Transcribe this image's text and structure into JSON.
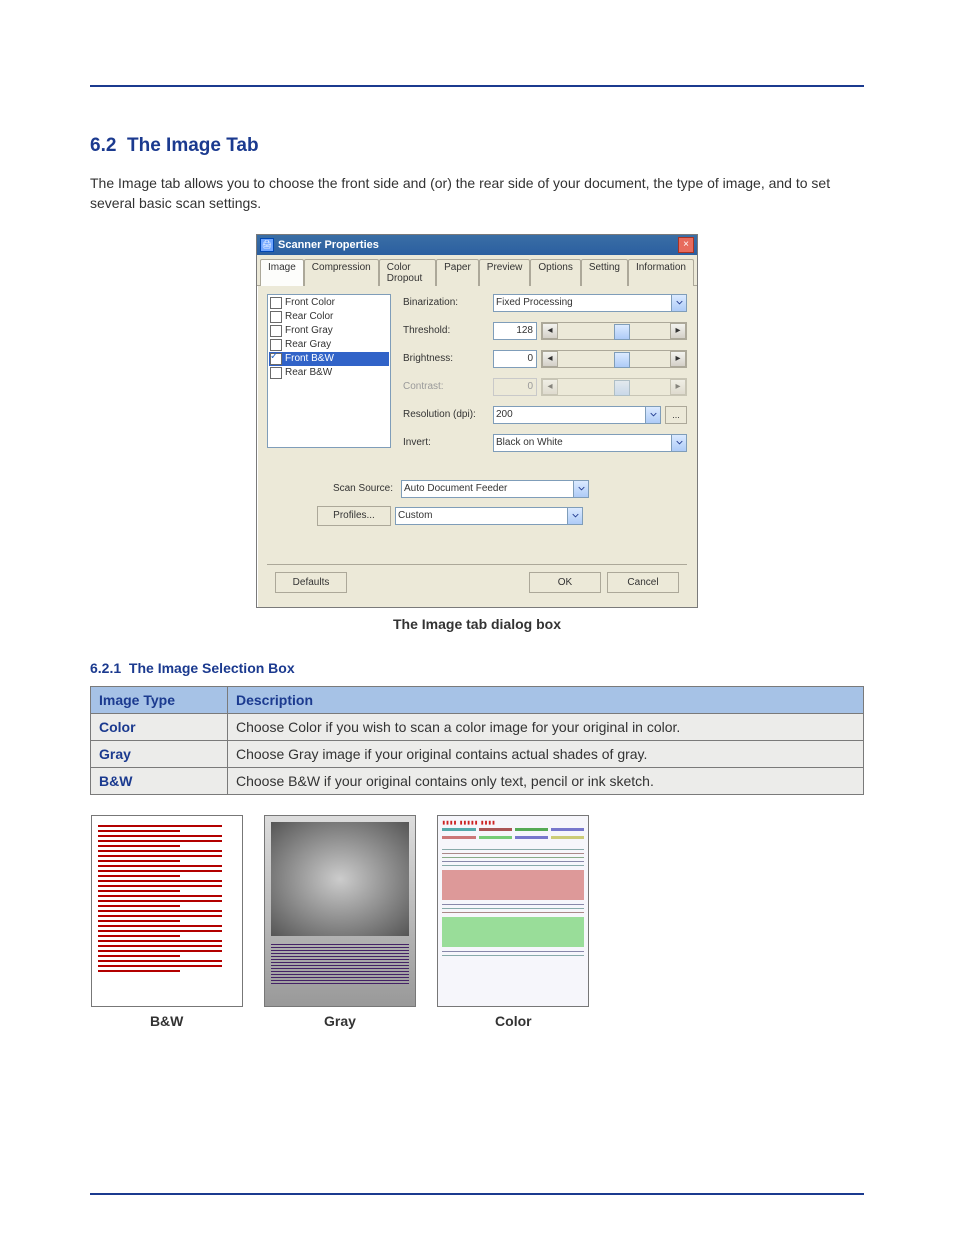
{
  "section": {
    "number": "6.2",
    "title": "The Image Tab",
    "intro": "The Image tab allows you to choose the front side and (or) the rear side of your document, the type of image, and to set several basic scan settings."
  },
  "dialog": {
    "title": "Scanner Properties",
    "close_icon": "×",
    "tabs": [
      "Image",
      "Compression",
      "Color Dropout",
      "Paper",
      "Preview",
      "Options",
      "Setting",
      "Information"
    ],
    "active_tab": 0,
    "side_list": [
      {
        "label": "Front Color",
        "checked": false
      },
      {
        "label": "Rear Color",
        "checked": false
      },
      {
        "label": "Front Gray",
        "checked": false
      },
      {
        "label": "Rear Gray",
        "checked": false
      },
      {
        "label": "Front B&W",
        "checked": true
      },
      {
        "label": "Rear B&W",
        "checked": false
      }
    ],
    "side_list_selected": 4,
    "settings": {
      "binarization": {
        "label": "Binarization:",
        "value": "Fixed Processing"
      },
      "threshold": {
        "label": "Threshold:",
        "value": "128"
      },
      "brightness": {
        "label": "Brightness:",
        "value": "0"
      },
      "contrast": {
        "label": "Contrast:",
        "value": "0",
        "disabled": true
      },
      "resolution": {
        "label": "Resolution (dpi):",
        "value": "200",
        "more": "..."
      },
      "invert": {
        "label": "Invert:",
        "value": "Black on White"
      }
    },
    "scan_source": {
      "label": "Scan Source:",
      "value": "Auto Document Feeder"
    },
    "profiles": {
      "button": "Profiles...",
      "value": "Custom"
    },
    "footer": {
      "defaults": "Defaults",
      "ok": "OK",
      "cancel": "Cancel"
    }
  },
  "caption": "The Image tab dialog box",
  "subsection": {
    "number": "6.2.1",
    "title": "The Image Selection Box"
  },
  "table": {
    "headers": [
      "Image Type",
      "Description"
    ],
    "rows": [
      {
        "type": "Color",
        "desc": "Choose Color if you wish to scan a color image for your original in color."
      },
      {
        "type": "Gray",
        "desc": "Choose Gray image if your original contains actual shades of gray."
      },
      {
        "type": "B&W",
        "desc": "Choose B&W if your original contains only text, pencil or ink sketch."
      }
    ]
  },
  "samples": {
    "bw": "B&W",
    "gray": "Gray",
    "color": "Color"
  }
}
